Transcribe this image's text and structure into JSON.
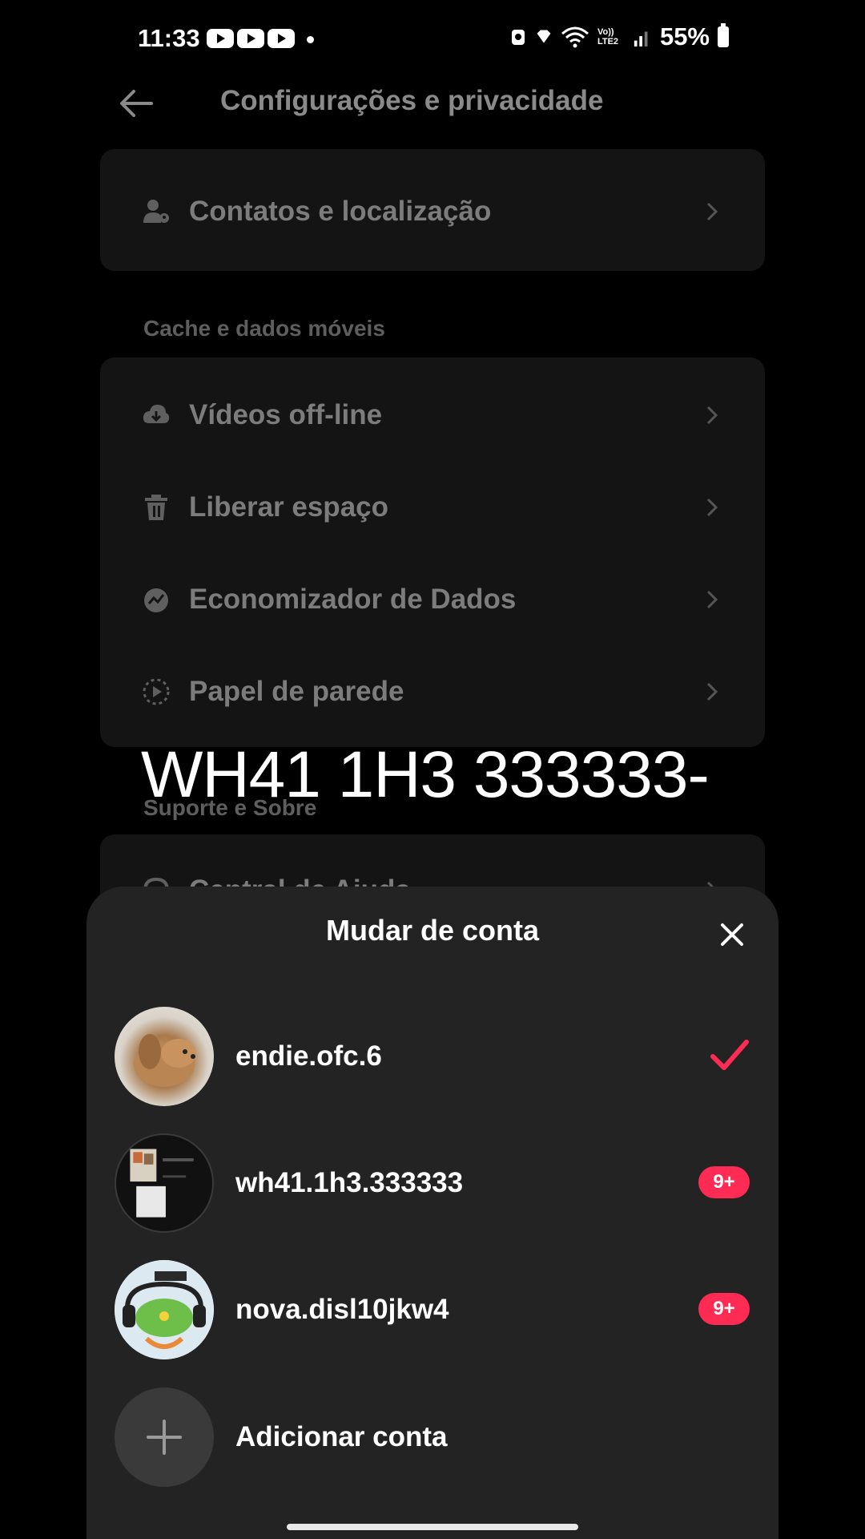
{
  "status_bar": {
    "time": "11:33",
    "network": "Vo)) LTE2",
    "battery": "55%"
  },
  "header": {
    "title": "Configurações e privacidade"
  },
  "settings": {
    "top_card": {
      "item": "Contatos e localização"
    },
    "cache_section": {
      "label": "Cache e dados móveis",
      "items": [
        "Vídeos off-line",
        "Liberar espaço",
        "Economizador de Dados",
        "Papel de parede"
      ]
    },
    "support_section": {
      "label": "Suporte e Sobre",
      "items": [
        "Central de Ajuda"
      ]
    }
  },
  "overlay_caption": "WH41 1H3 333333-",
  "sheet": {
    "title": "Mudar de conta",
    "accounts": [
      {
        "username": "endie.ofc.6",
        "active": true
      },
      {
        "username": "wh41.1h3.333333",
        "badge": "9+"
      },
      {
        "username": "nova.disl10jkw4",
        "badge": "9+"
      }
    ],
    "add_account": "Adicionar conta"
  },
  "colors": {
    "accent": "#fe2c55",
    "sheet_bg": "#232323",
    "background": "#000000"
  }
}
